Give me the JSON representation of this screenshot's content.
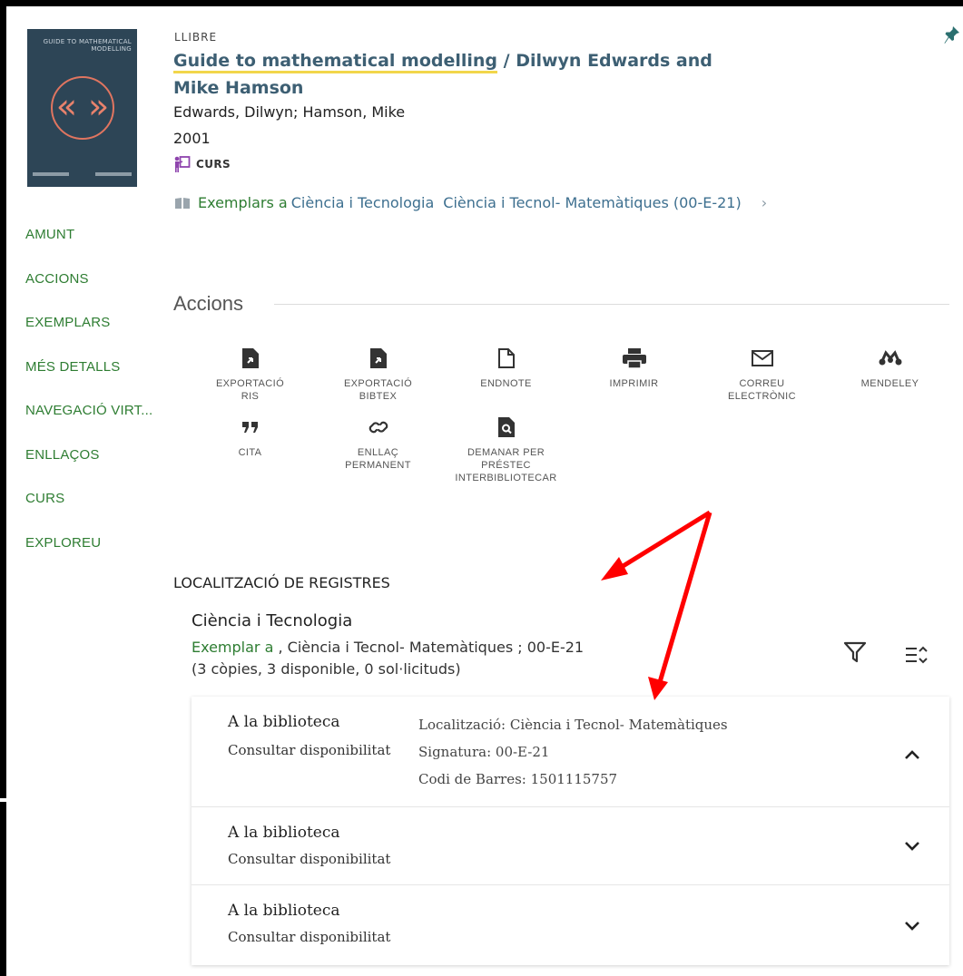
{
  "record": {
    "type": "LLIBRE",
    "title_main": "Guide to mathematical modelling",
    "title_rest": " / Dilwyn Edwards and Mike Hamson",
    "authors": "Edwards, Dilwyn; Hamson, Mike",
    "year": "2001",
    "course_badge": "CURS",
    "cover": {
      "title_line1": "GUIDE TO MATHEMATICAL",
      "title_line2": "MODELLING",
      "arrows": "« »"
    }
  },
  "availability": {
    "prefix": "Exemplars a",
    "library": "Ciència i Tecnologia",
    "location": "Ciència i Tecnol- Matemàtiques (00-E-21)"
  },
  "left_nav": [
    "AMUNT",
    "ACCIONS",
    "EXEMPLARS",
    "MÉS DETALLS",
    "NAVEGACIÓ VIRT...",
    "ENLLAÇOS",
    "CURS",
    "EXPLOREU"
  ],
  "actions": {
    "heading": "Accions",
    "items": [
      {
        "label_line1": "EXPORTACIÓ",
        "label_line2": "RIS",
        "label_line3": "",
        "icon": "export-ris-icon"
      },
      {
        "label_line1": "EXPORTACIÓ",
        "label_line2": "BIBTEX",
        "label_line3": "",
        "icon": "export-bibtex-icon"
      },
      {
        "label_line1": "ENDNOTE",
        "label_line2": "",
        "label_line3": "",
        "icon": "endnote-icon"
      },
      {
        "label_line1": "IMPRIMIR",
        "label_line2": "",
        "label_line3": "",
        "icon": "print-icon"
      },
      {
        "label_line1": "CORREU",
        "label_line2": "ELECTRÒNIC",
        "label_line3": "",
        "icon": "email-icon"
      },
      {
        "label_line1": "MENDELEY",
        "label_line2": "",
        "label_line3": "",
        "icon": "mendeley-icon"
      },
      {
        "label_line1": "CITA",
        "label_line2": "",
        "label_line3": "",
        "icon": "quote-icon"
      },
      {
        "label_line1": "ENLLAÇ",
        "label_line2": "PERMANENT",
        "label_line3": "",
        "icon": "link-icon"
      },
      {
        "label_line1": "DEMANAR PER",
        "label_line2": "PRÉSTEC",
        "label_line3": "INTERBIBLIOTECAR",
        "icon": "interlibrary-loan-icon"
      }
    ]
  },
  "locations": {
    "heading": "LOCALITZACIÓ DE REGISTRES",
    "library_name": "Ciència i Tecnologia",
    "exemplar_prefix": "Exemplar a",
    "exemplar_rest": " , Ciència i Tecnol- Matemàtiques ; 00-E-21",
    "counts": "(3 còpies, 3 disponible, 0 sol·licituds)",
    "items": [
      {
        "status": "A la biblioteca",
        "sub": "Consultar disponibilitat",
        "location": "Localització: Ciència i Tecnol- Matemàtiques",
        "signature": "Signatura: 00-E-21",
        "barcode": "Codi de Barres: 1501115757",
        "expanded": true
      },
      {
        "status": "A la biblioteca",
        "sub": "Consultar disponibilitat",
        "expanded": false
      },
      {
        "status": "A la biblioteca",
        "sub": "Consultar disponibilitat",
        "expanded": false
      }
    ]
  },
  "colors": {
    "green": "#2e7d32",
    "title": "#3d5f73",
    "highlight": "#f2d64b",
    "annotation": "#ff0000"
  }
}
